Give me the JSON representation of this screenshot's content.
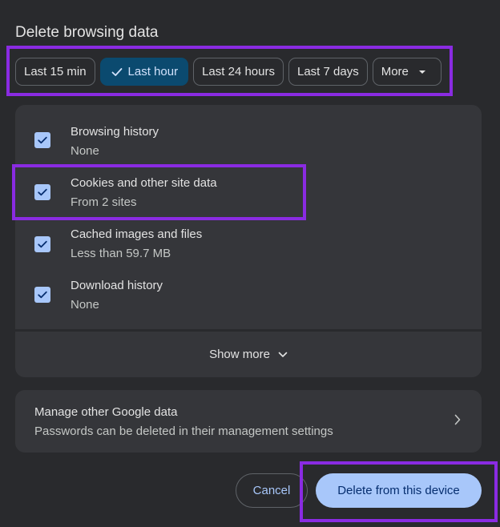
{
  "dialog": {
    "title": "Delete browsing data"
  },
  "time_ranges": [
    {
      "label": "Last 15 min",
      "selected": false
    },
    {
      "label": "Last hour",
      "selected": true
    },
    {
      "label": "Last 24 hours",
      "selected": false
    },
    {
      "label": "Last 7 days",
      "selected": false
    },
    {
      "label": "More",
      "selected": false
    }
  ],
  "data_items": [
    {
      "title": "Browsing history",
      "subtitle": "None",
      "checked": true
    },
    {
      "title": "Cookies and other site data",
      "subtitle": "From 2 sites",
      "checked": true
    },
    {
      "title": "Cached images and files",
      "subtitle": "Less than 59.7 MB",
      "checked": true
    },
    {
      "title": "Download history",
      "subtitle": "None",
      "checked": true
    }
  ],
  "show_more": {
    "label": "Show more"
  },
  "manage": {
    "title": "Manage other Google data",
    "subtitle": "Passwords can be deleted in their management settings"
  },
  "actions": {
    "cancel_label": "Cancel",
    "delete_label": "Delete from this device"
  },
  "colors": {
    "dialog_bg": "#292a2d",
    "panel_bg": "#35363a",
    "accent": "#a8c7fa",
    "selected_chip": "#0b4a6f",
    "highlight": "#8a2be2"
  }
}
